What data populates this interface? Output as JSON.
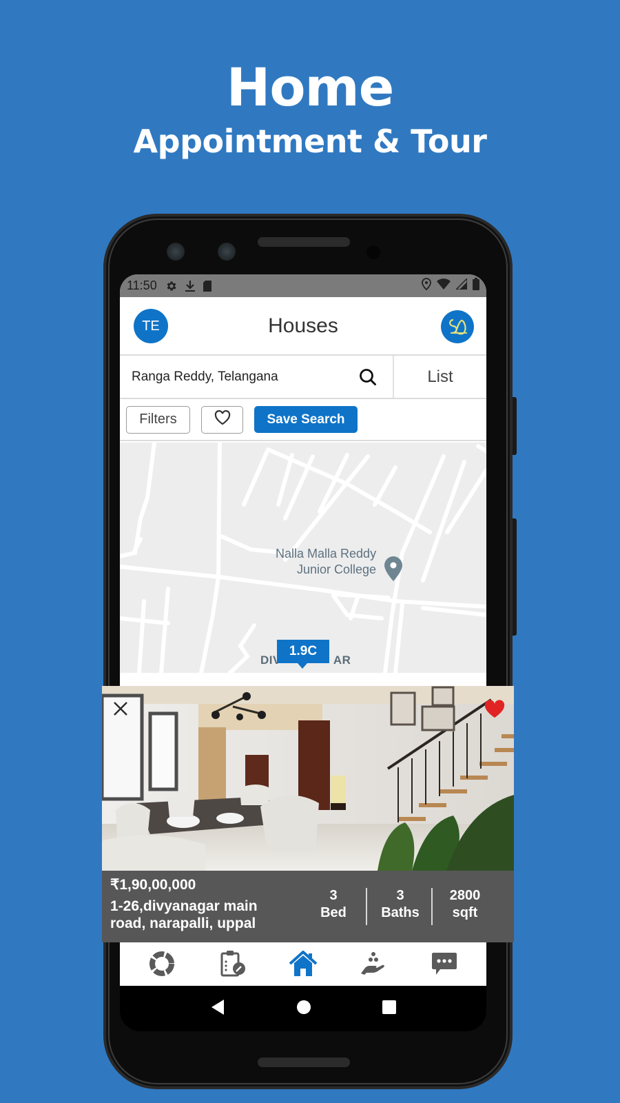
{
  "promo": {
    "title": "Home",
    "subtitle": "Appointment & Tour"
  },
  "statusbar": {
    "time": "11:50",
    "left_icons": [
      "gear-icon",
      "download-icon",
      "sd-card-icon"
    ],
    "right_icons": [
      "location-icon",
      "wifi-icon",
      "signal-icon",
      "battery-icon"
    ]
  },
  "appbar": {
    "avatar_initials": "TE",
    "title": "Houses",
    "logo_icon": "brand-logo-icon"
  },
  "search": {
    "value": "Ranga Reddy, Telangana",
    "placeholder": "Search location",
    "list_label": "List"
  },
  "filters": {
    "filters_label": "Filters",
    "favorite_icon": "heart-outline-icon",
    "save_search_label": "Save Search"
  },
  "map": {
    "poi_line1": "Nalla Malla Reddy",
    "poi_line2": "Junior College",
    "area_label_left": "DIV",
    "area_label_right": "AR",
    "price_marker": "1.9C"
  },
  "listing": {
    "price": "₹1,90,00,000",
    "address_line1": "1-26,divyanagar main",
    "address_line2": "road, narapalli, uppal",
    "beds_value": "3",
    "beds_label": "Bed",
    "baths_value": "3",
    "baths_label": "Baths",
    "area_value": "2800",
    "area_label": "sqft",
    "favorited": true
  },
  "bottom_nav": {
    "items": [
      {
        "icon": "donut-chart-icon",
        "active": false
      },
      {
        "icon": "clipboard-edit-icon",
        "active": false
      },
      {
        "icon": "home-icon",
        "active": true
      },
      {
        "icon": "hand-coins-icon",
        "active": false
      },
      {
        "icon": "chat-bubble-icon",
        "active": false
      }
    ]
  },
  "colors": {
    "background": "#3079c1",
    "accent": "#0f74c8",
    "card_info_bg": "#575757",
    "heart": "#e02424",
    "nav_inactive": "#5a5a5a"
  }
}
